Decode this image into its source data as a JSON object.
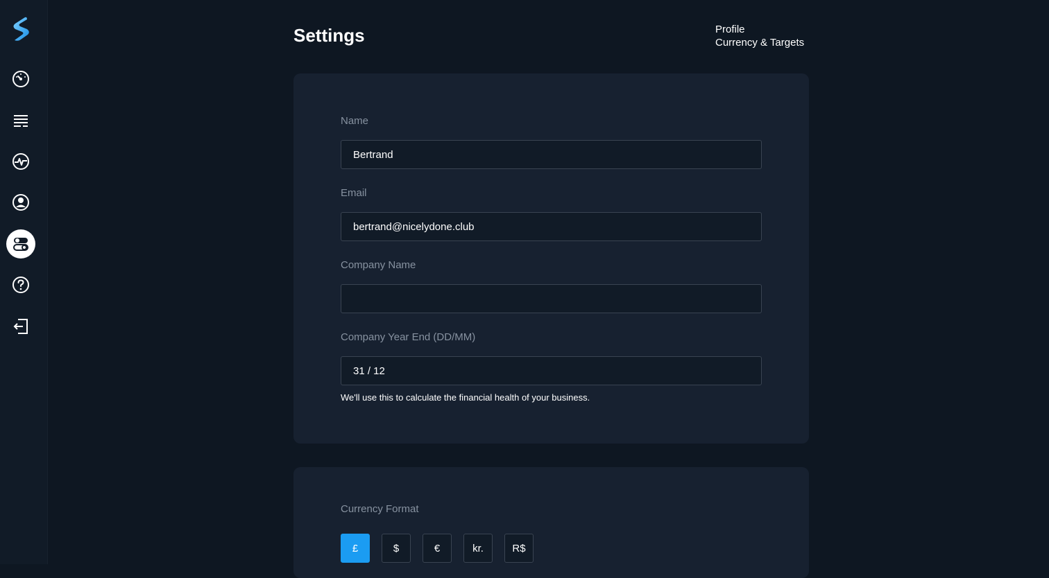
{
  "page": {
    "title": "Settings"
  },
  "page_nav": {
    "items": [
      "Profile",
      "Currency & Targets"
    ]
  },
  "sidebar": {
    "logo": "logo-icon",
    "items": [
      {
        "icon": "dashboard-gauge-icon",
        "active": false
      },
      {
        "icon": "list-icon",
        "active": false
      },
      {
        "icon": "activity-pulse-icon",
        "active": false
      },
      {
        "icon": "user-profile-icon",
        "active": false
      },
      {
        "icon": "toggle-settings-icon",
        "active": true
      },
      {
        "icon": "help-question-icon",
        "active": false
      },
      {
        "icon": "logout-icon",
        "active": false
      }
    ]
  },
  "profile": {
    "name": {
      "label": "Name",
      "value": "Bertrand"
    },
    "email": {
      "label": "Email",
      "value": "bertrand@nicelydone.club"
    },
    "company_name": {
      "label": "Company Name",
      "value": ""
    },
    "year_end": {
      "label": "Company Year End (DD/MM)",
      "value": "31 / 12",
      "helper": "We'll use this to calculate the financial health of your business."
    }
  },
  "currency": {
    "label": "Currency Format",
    "options": [
      "£",
      "$",
      "€",
      "kr.",
      "R$"
    ],
    "selected": "£"
  },
  "colors": {
    "background": "#0e1722",
    "sidebar": "#111b27",
    "card": "#172130",
    "accent": "#1b9cf2",
    "label": "#8792a0"
  }
}
